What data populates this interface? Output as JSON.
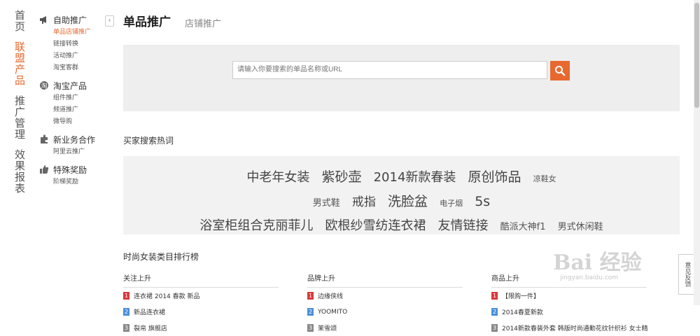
{
  "main_nav": [
    {
      "label": "首页",
      "active": false
    },
    {
      "label": "联盟产品",
      "active": true
    },
    {
      "label": "推广管理",
      "active": false
    },
    {
      "label": "效果报表",
      "active": false
    }
  ],
  "sub_nav": {
    "groups": [
      {
        "title": "自助推广",
        "icon": "megaphone-icon",
        "items": [
          {
            "label": "单品店铺推广",
            "active": true
          },
          {
            "label": "链接转换",
            "active": false
          },
          {
            "label": "活动推广",
            "active": false
          },
          {
            "label": "淘宝客群",
            "active": false
          }
        ]
      },
      {
        "title": "淘宝产品",
        "icon": "taobao-icon",
        "items": [
          {
            "label": "组件推广",
            "active": false
          },
          {
            "label": "频道推广",
            "active": false
          },
          {
            "label": "微导购",
            "active": false
          }
        ]
      },
      {
        "title": "新业务合作",
        "icon": "puzzle-icon",
        "items": [
          {
            "label": "阿里云推广",
            "active": false
          }
        ]
      },
      {
        "title": "特殊奖励",
        "icon": "thumbs-up-icon",
        "items": [
          {
            "label": "阶梯奖励",
            "active": false
          }
        ]
      }
    ]
  },
  "tabs": [
    {
      "label": "单品推广",
      "active": true
    },
    {
      "label": "店铺推广",
      "active": false
    }
  ],
  "search": {
    "placeholder": "请输入你要搜索的单品名称或URL",
    "value": ""
  },
  "hot": {
    "title": "买家搜索热词",
    "rows": [
      [
        {
          "t": "中老年女装",
          "s": "l"
        },
        {
          "t": "紫砂壶",
          "s": "xl"
        },
        {
          "t": "2014新款春装",
          "s": "l"
        },
        {
          "t": "原创饰品",
          "s": "xl"
        },
        {
          "t": "凉鞋女",
          "s": "s"
        }
      ],
      [
        {
          "t": "男式鞋",
          "s": "sm"
        },
        {
          "t": "戒指",
          "s": "m"
        },
        {
          "t": "洗脸盆",
          "s": "xl"
        },
        {
          "t": "电子烟",
          "s": "s"
        },
        {
          "t": "5s",
          "s": "xl"
        }
      ],
      [
        {
          "t": "浴室柜组合克丽菲儿",
          "s": "l"
        },
        {
          "t": "欧根纱雪纺连衣裙",
          "s": "l"
        },
        {
          "t": "友情链接",
          "s": "l"
        },
        {
          "t": "酷派大神f1",
          "s": "sm"
        },
        {
          "t": "男式休闲鞋",
          "s": "sm"
        }
      ]
    ]
  },
  "rank": {
    "title": "时尚女装类目排行榜",
    "columns": [
      {
        "head": "关注上升",
        "rows": [
          "连衣裙 2014 春款 新品",
          "新品连衣裙",
          "裂帛 旗舰店"
        ]
      },
      {
        "head": "品牌上升",
        "rows": [
          "边缘侠线",
          "YOOMITO",
          "茉雪颂"
        ]
      },
      {
        "head": "商品上升",
        "rows": [
          "【限购一件】",
          "2014春夏新款",
          "2014新款春装外套 韩版时尚通勤花纹针织衫 女士精"
        ]
      }
    ]
  },
  "watermark": {
    "text": "Bai 经验",
    "sub": "jingyan.baidu.com"
  },
  "feedback": {
    "label": "意见反馈"
  },
  "colors": {
    "accent": "#e8692f",
    "rank1": "#d9383a",
    "rank2": "#4a8fd8",
    "rank3": "#888888"
  }
}
